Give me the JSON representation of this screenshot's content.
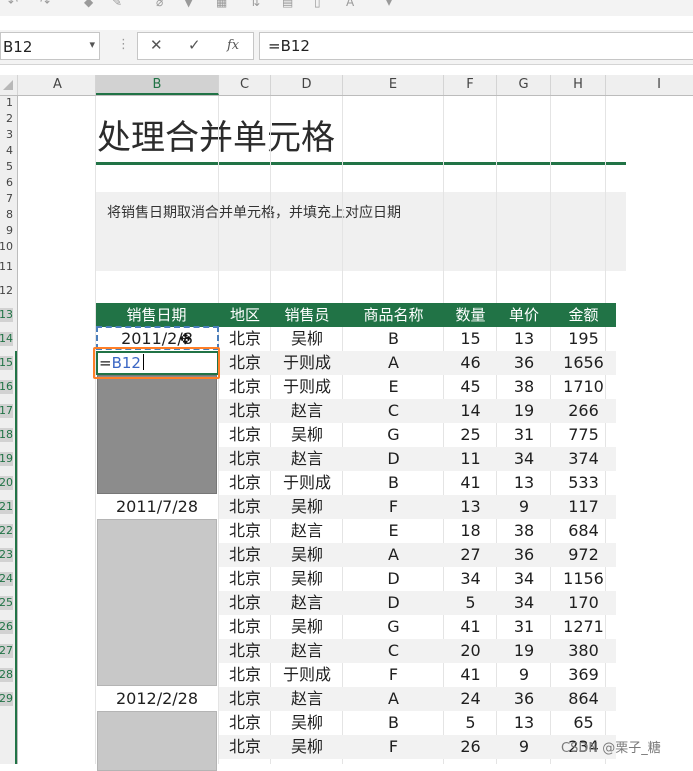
{
  "toolbar": {
    "icons": [
      "undo-icon",
      "redo-icon",
      "eraser-icon",
      "pen-icon",
      "clear-format-icon",
      "filter-icon",
      "table-icon",
      "sort-icon",
      "insert-chart-icon",
      "blank-doc-icon",
      "font-color-icon",
      "more-icon"
    ]
  },
  "formula_bar": {
    "name_box": "B12",
    "cancel_symbol": "✕",
    "enter_symbol": "✓",
    "fx_symbol": "fx",
    "formula": "=B12"
  },
  "columns": [
    "A",
    "B",
    "C",
    "D",
    "E",
    "F",
    "G",
    "H",
    "I"
  ],
  "selected_column": "B",
  "rows": [
    "1",
    "2",
    "3",
    "4",
    "5",
    "6",
    "7",
    "8",
    "9",
    "10",
    "11",
    "12",
    "13",
    "14",
    "15",
    "16",
    "17",
    "18",
    "19",
    "20",
    "21",
    "22",
    "23",
    "24",
    "25",
    "26",
    "27",
    "28",
    "29"
  ],
  "sheet": {
    "title": "处理合并单元格",
    "description": "将销售日期取消合并单元格，并填充上对应日期",
    "headers": [
      "销售日期",
      "地区",
      "销售员",
      "商品名称",
      "数量",
      "单价",
      "金额"
    ],
    "dates": [
      "2011/2/8",
      "2011/7/28",
      "2012/2/28"
    ],
    "rows": [
      [
        "北京",
        "吴柳",
        "B",
        "15",
        "13",
        "195"
      ],
      [
        "北京",
        "于则成",
        "A",
        "46",
        "36",
        "1656"
      ],
      [
        "北京",
        "于则成",
        "E",
        "45",
        "38",
        "1710"
      ],
      [
        "北京",
        "赵言",
        "C",
        "14",
        "19",
        "266"
      ],
      [
        "北京",
        "吴柳",
        "G",
        "25",
        "31",
        "775"
      ],
      [
        "北京",
        "赵言",
        "D",
        "11",
        "34",
        "374"
      ],
      [
        "北京",
        "于则成",
        "B",
        "41",
        "13",
        "533"
      ],
      [
        "北京",
        "吴柳",
        "F",
        "13",
        "9",
        "117"
      ],
      [
        "北京",
        "赵言",
        "E",
        "18",
        "38",
        "684"
      ],
      [
        "北京",
        "吴柳",
        "A",
        "27",
        "36",
        "972"
      ],
      [
        "北京",
        "吴柳",
        "D",
        "34",
        "34",
        "1156"
      ],
      [
        "北京",
        "赵言",
        "D",
        "5",
        "34",
        "170"
      ],
      [
        "北京",
        "吴柳",
        "G",
        "41",
        "31",
        "1271"
      ],
      [
        "北京",
        "赵言",
        "C",
        "20",
        "19",
        "380"
      ],
      [
        "北京",
        "于则成",
        "F",
        "41",
        "9",
        "369"
      ],
      [
        "北京",
        "赵言",
        "A",
        "24",
        "36",
        "864"
      ],
      [
        "北京",
        "吴柳",
        "B",
        "5",
        "13",
        "65"
      ],
      [
        "北京",
        "吴柳",
        "F",
        "26",
        "9",
        "234"
      ]
    ]
  },
  "edit": {
    "prefix": "=",
    "ref": "B12"
  },
  "watermark": "CSDN @栗子_糖",
  "colors": {
    "accent": "#217346",
    "highlight": "#ff7f27",
    "marquee": "#4a7ebb"
  }
}
